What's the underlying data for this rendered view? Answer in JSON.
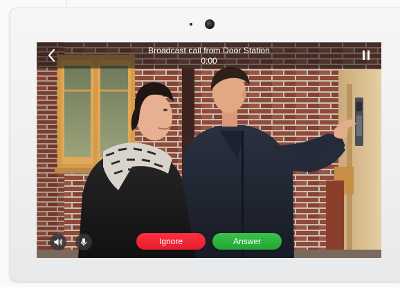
{
  "call": {
    "title": "Broadcast call from Door Station",
    "duration": "0:00"
  },
  "controls": {
    "ignore_label": "Ignore",
    "answer_label": "Answer"
  },
  "icons": {
    "back": "chevron-left-icon",
    "pause": "pause-icon",
    "speaker": "speaker-icon",
    "mic": "microphone-icon"
  },
  "colors": {
    "ignore": "#f0202f",
    "answer": "#2fb23f",
    "overlay": "#141414"
  }
}
